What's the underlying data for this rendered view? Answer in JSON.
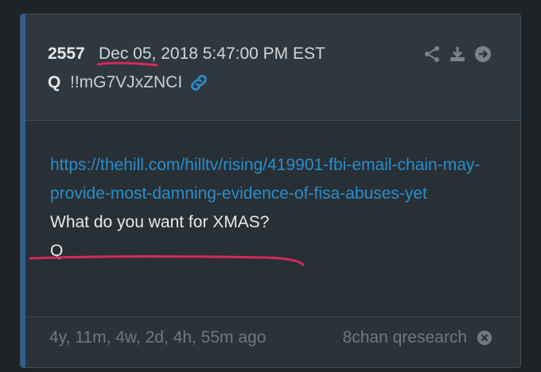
{
  "post": {
    "number": "2557",
    "date": "Dec 05, 2018 5:47:00 PM EST",
    "author": "Q",
    "tripcode": "!!mG7VJxZNCI",
    "url": "https://thehill.com/hilltv/rising/419901-fbi-email-chain-may-provide-most-damning-evidence-of-fisa-abuses-yet",
    "lines": [
      "What do you want for XMAS?",
      "Q"
    ],
    "age": "4y, 11m, 4w, 2d, 4h, 55m ago",
    "source": "8chan qresearch"
  },
  "icons": {
    "permalink": "link-icon",
    "share": "share-icon",
    "download": "download-icon",
    "open": "arrow-right-circle-icon",
    "dismiss": "close-circle-icon"
  },
  "colors": {
    "accent_bar": "#2c5f95",
    "link": "#2b8ccb",
    "highlight_marker": "#d6285f"
  }
}
